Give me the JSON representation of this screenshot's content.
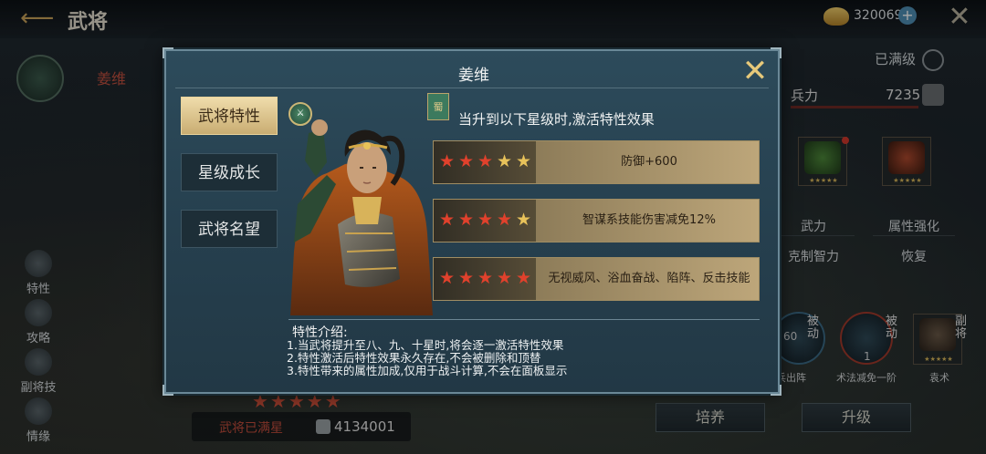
{
  "header": {
    "title": "武将",
    "back_icon": "back-arrow-icon",
    "coin_icon": "gold-ingot-icon",
    "coin_value": "320069",
    "add_icon": "plus-icon",
    "close_icon": "close-icon"
  },
  "left_panel": {
    "hero_name": "姜维",
    "nav": [
      "特性",
      "攻略",
      "副将技",
      "情缘"
    ],
    "stars": "★★★★★",
    "max_star_label": "武将已满星",
    "power_value": "4134001"
  },
  "right_panel": {
    "level_status": "已满级",
    "troops_label": "兵力",
    "troops_value": "7235",
    "attr_labels": [
      "武力",
      "属性强化",
      "克制智力",
      "恢复"
    ],
    "card_stars": "★★★★★",
    "skills": [
      {
        "tag": "被动",
        "name": "兵出阵",
        "level": "60"
      },
      {
        "tag": "被动",
        "name": "术法减免一阶",
        "level": "1"
      },
      {
        "tag": "副将",
        "name": "袁术"
      }
    ],
    "buttons": [
      "培养",
      "升级"
    ]
  },
  "dialog": {
    "title": "姜维",
    "close_icon": "close-icon",
    "tabs": [
      {
        "label": "武将特性",
        "active": true
      },
      {
        "label": "星级成长",
        "active": false
      },
      {
        "label": "武将名望",
        "active": false
      }
    ],
    "faction_flag": "蜀",
    "requirement_text": "当升到以下星级时,激活特性效果",
    "rows": [
      {
        "stars_lit": 3,
        "stars_total": 5,
        "effect": "防御+600"
      },
      {
        "stars_lit": 4,
        "stars_total": 5,
        "effect": "智谋系技能伤害减免12%"
      },
      {
        "stars_lit": 5,
        "stars_total": 5,
        "effect": "无视威风、浴血奋战、陷阵、反击技能"
      }
    ],
    "info_title": "特性介绍:",
    "info_lines": [
      "1.当武将提升至八、九、十星时,将会逐一激活特性效果",
      "2.特性激活后特性效果永久存在,不会被删除和顶替",
      "3.特性带来的属性加成,仅用于战斗计算,不会在面板显示"
    ],
    "colors": {
      "star_lit": "#e0412c",
      "star_unlit": "#e8c25a",
      "active_tab": "#e3cc94"
    }
  }
}
